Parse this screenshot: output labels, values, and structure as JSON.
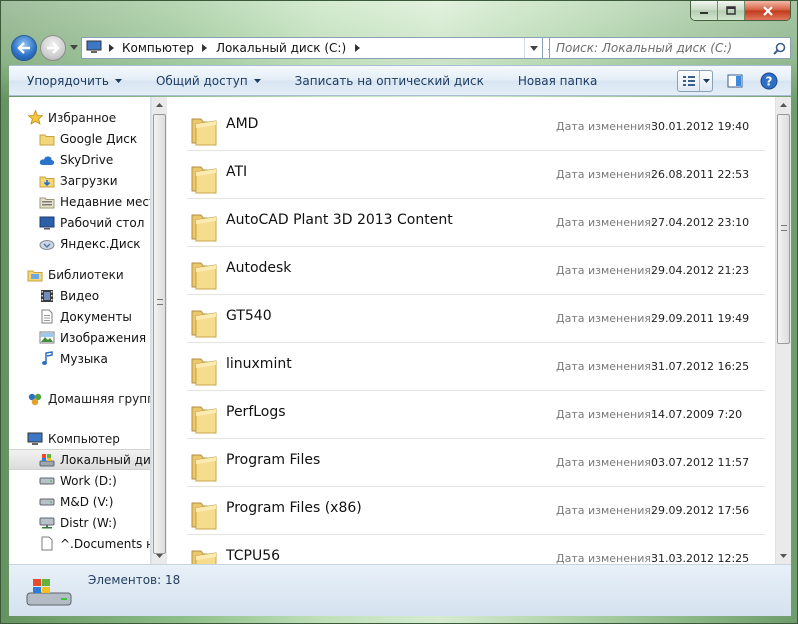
{
  "window": {
    "minimize_icon": "minimize-icon",
    "maximize_icon": "maximize-icon",
    "close_icon": "close-icon"
  },
  "nav": {
    "breadcrumb": [
      "Компьютер",
      "Локальный диск (C:)"
    ],
    "search_placeholder": "Поиск: Локальный диск (C:)"
  },
  "toolbar": {
    "organize": "Упорядочить",
    "share": "Общий доступ",
    "burn": "Записать на оптический диск",
    "new_folder": "Новая папка"
  },
  "sidebar": {
    "favorites": {
      "label": "Избранное",
      "items": [
        "Google Диск",
        "SkyDrive",
        "Загрузки",
        "Недавние места",
        "Рабочий стол",
        "Яндекс.Диск"
      ]
    },
    "libraries": {
      "label": "Библиотеки",
      "items": [
        "Видео",
        "Документы",
        "Изображения",
        "Музыка"
      ]
    },
    "homegroup": {
      "label": "Домашняя группа"
    },
    "computer": {
      "label": "Компьютер",
      "items": [
        "Локальный диск (C:)",
        "Work (D:)",
        "M&D (V:)",
        "Distr (W:)",
        "^.Documents на"
      ]
    }
  },
  "files": {
    "date_label": "Дата изменения:",
    "items": [
      {
        "name": "AMD",
        "date": "30.01.2012 19:40"
      },
      {
        "name": "ATI",
        "date": "26.08.2011 22:53"
      },
      {
        "name": "AutoCAD Plant 3D 2013 Content",
        "date": "27.04.2012 23:10"
      },
      {
        "name": "Autodesk",
        "date": "29.04.2012 21:23"
      },
      {
        "name": "GT540",
        "date": "29.09.2011 19:49"
      },
      {
        "name": "linuxmint",
        "date": "31.07.2012 16:25"
      },
      {
        "name": "PerfLogs",
        "date": "14.07.2009 7:20"
      },
      {
        "name": "Program Files",
        "date": "03.07.2012 11:57"
      },
      {
        "name": "Program Files (x86)",
        "date": "29.09.2012 17:56"
      },
      {
        "name": "TCPU56",
        "date": "31.03.2012 12:25"
      }
    ]
  },
  "status": {
    "count": "Элементов: 18"
  }
}
